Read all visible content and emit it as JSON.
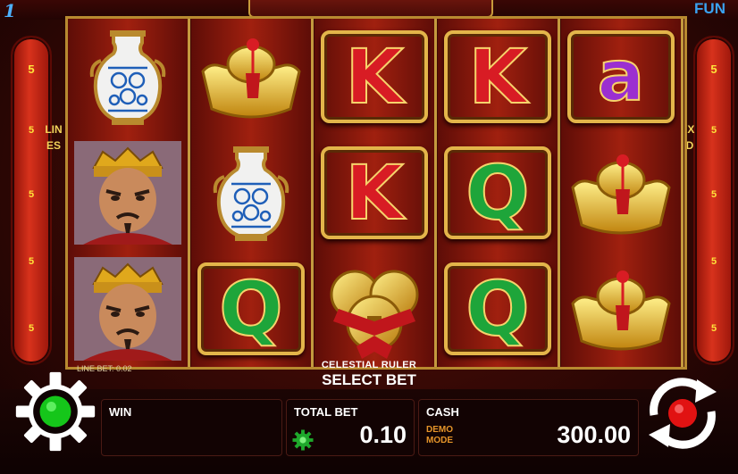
{
  "header": {
    "brand_mark": "1",
    "mode_label": "FUN"
  },
  "left_panel": {
    "numbers": [
      "5",
      "5",
      "5",
      "5",
      "5"
    ],
    "word": "LINES"
  },
  "right_panel": {
    "numbers": [
      "5",
      "5",
      "5",
      "5",
      "5"
    ],
    "word": "FIXED"
  },
  "reels": [
    [
      "vase",
      "emperor",
      "emperor"
    ],
    [
      "gold-ingot",
      "vase",
      "letter-q"
    ],
    [
      "letter-k",
      "letter-k",
      "gold-coins"
    ],
    [
      "letter-k",
      "letter-q",
      "letter-q"
    ],
    [
      "letter-a",
      "gold-ingot",
      "gold-ingot"
    ]
  ],
  "symbol_glyphs": {
    "letter-k": "K",
    "letter-q": "Q",
    "letter-a": "a"
  },
  "info": {
    "line_bet": "LINE BET: 0.02",
    "game_name": "CELESTIAL RULER",
    "select_bet": "SELECT BET"
  },
  "bottom": {
    "win_label": "WIN",
    "win_value": "",
    "total_bet_label": "TOTAL BET",
    "total_bet_value": "0.10",
    "cash_label": "CASH",
    "cash_value": "300.00",
    "demo_mode": "DEMO MODE"
  },
  "colors": {
    "panel_red": "#d8321c",
    "gold": "#c79a3b",
    "number_yellow": "#ffe23a",
    "demo_orange": "#e6952a",
    "settings_green": "#15c61a",
    "spin_red": "#e11212",
    "brand_blue": "#4db1ff"
  }
}
